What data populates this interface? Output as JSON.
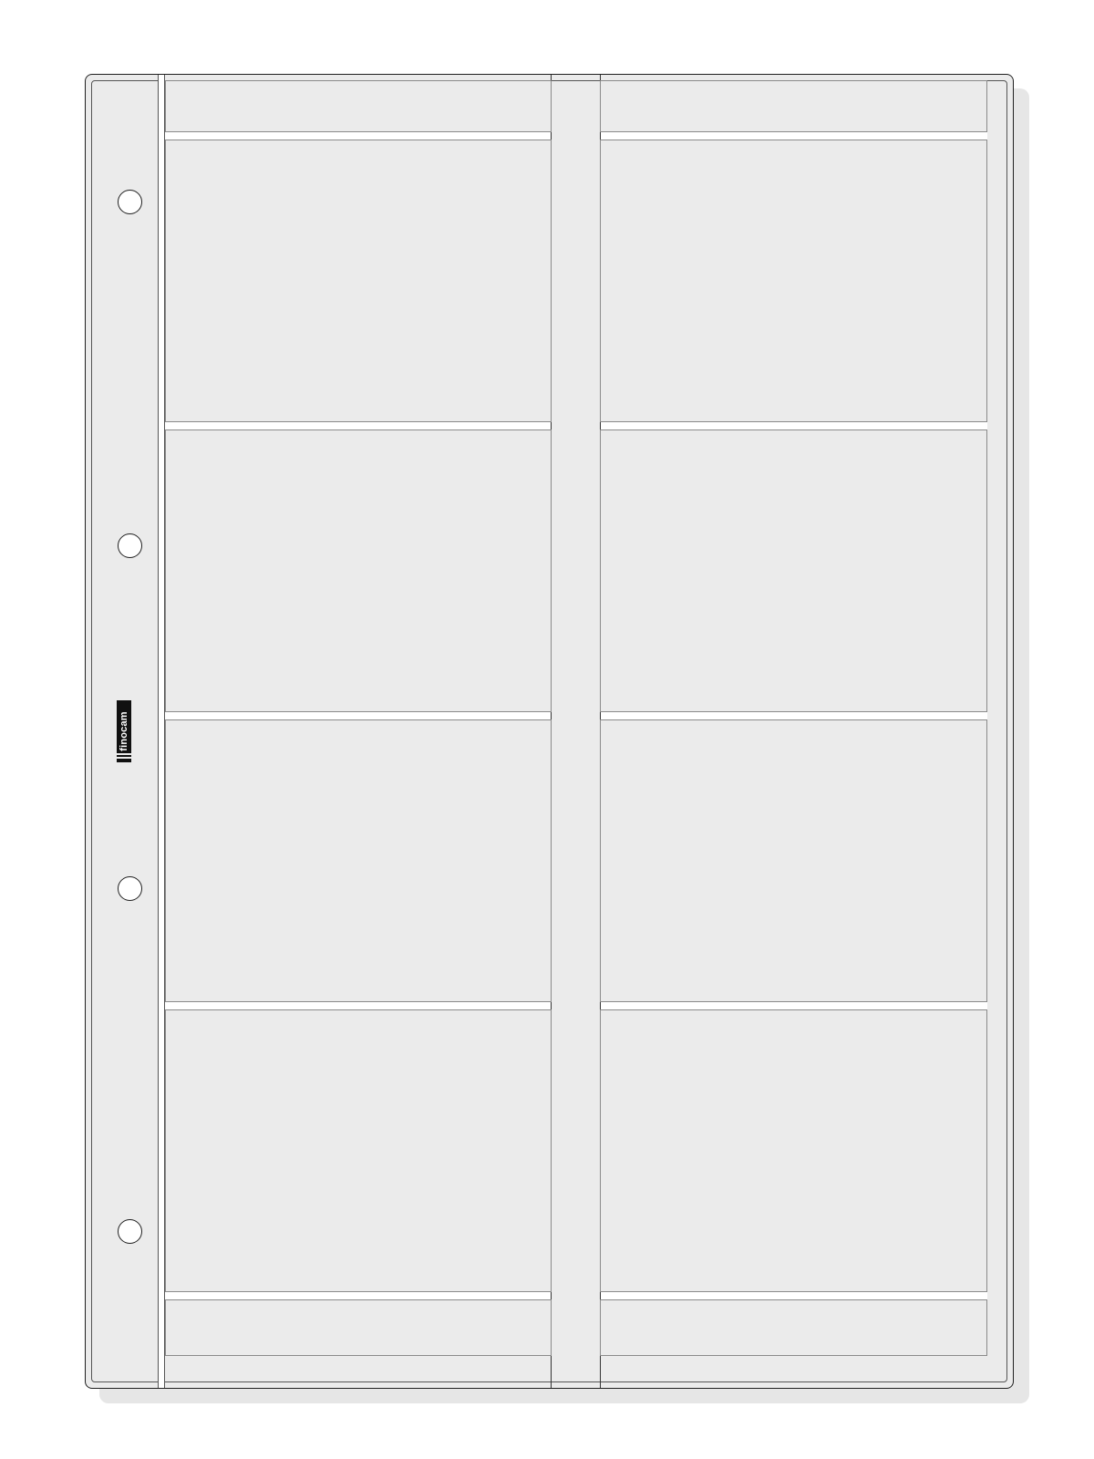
{
  "sheet": {
    "brand_label": "finocam",
    "pocket_rows": 4,
    "pocket_columns": 2,
    "punch_holes": 4,
    "colors": {
      "sheet_fill": "#ebebeb",
      "outline": "#1f1f1f",
      "separator": "#ffffff",
      "shadow": "#e6e6e6"
    }
  }
}
